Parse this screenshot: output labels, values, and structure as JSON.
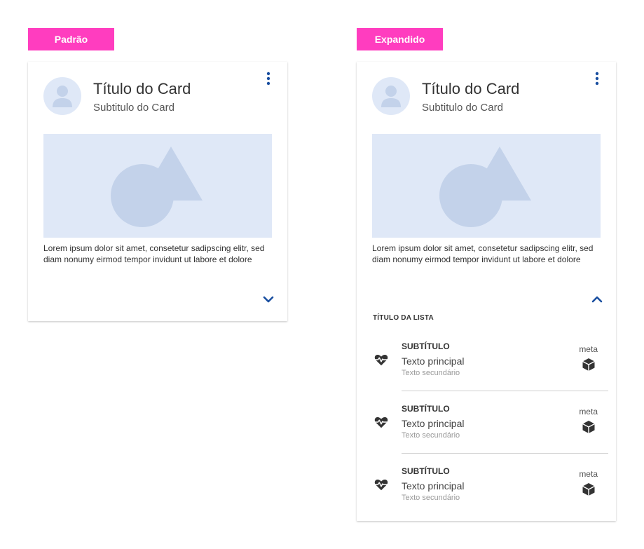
{
  "tags": {
    "default": "Padrão",
    "expanded": "Expandido"
  },
  "card": {
    "title": "Título do Card",
    "subtitle": "Subtitulo do Card",
    "text": "Lorem ipsum dolor sit amet, consetetur sadipscing elitr, sed diam nonumy eirmod tempor invidunt ut labore et dolore"
  },
  "list": {
    "title": "TÍTULO DA LISTA",
    "items": [
      {
        "subtitle": "SUBTÍTULO",
        "main": "Texto principal",
        "secondary": "Texto secundário",
        "meta": "meta"
      },
      {
        "subtitle": "SUBTÍTULO",
        "main": "Texto principal",
        "secondary": "Texto secundário",
        "meta": "meta"
      },
      {
        "subtitle": "SUBTÍTULO",
        "main": "Texto principal",
        "secondary": "Texto secundário",
        "meta": "meta"
      }
    ]
  },
  "icons": {
    "avatar": "person-avatar-icon",
    "menu": "more-vert-icon",
    "media": "shapes-placeholder-icon",
    "expand": "chevron-down-icon",
    "collapse": "chevron-up-icon",
    "list_leading": "heart-pulse-icon",
    "list_trailing": "cube-icon"
  },
  "colors": {
    "tag_background": "#ff3dbf",
    "accent": "#1a4fa0",
    "placeholder_background": "#dfe8f7",
    "placeholder_shape": "#c3d2ea"
  }
}
